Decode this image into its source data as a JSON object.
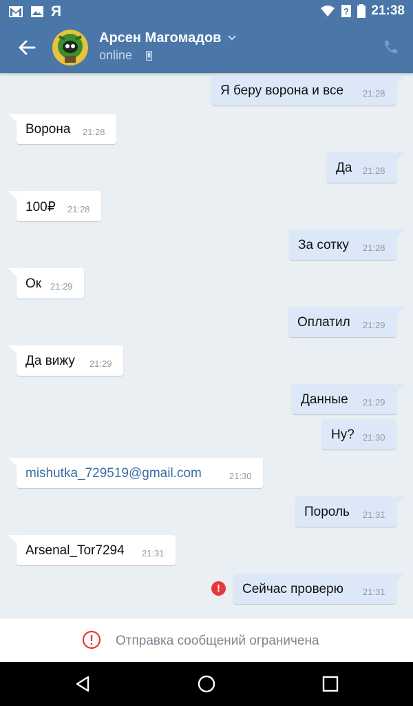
{
  "status_bar": {
    "time": "21:38",
    "left_icons": [
      "gmail-icon",
      "image-icon",
      "yandex-icon"
    ],
    "yandex_glyph": "Я",
    "right_icons": [
      "wifi-icon",
      "signal-icon",
      "battery-icon"
    ]
  },
  "header": {
    "contact_name": "Арсен Магомадов",
    "presence": "online",
    "icons": [
      "back-arrow-icon",
      "avatar",
      "chevron-down-icon",
      "mobile-icon",
      "phone-call-icon"
    ]
  },
  "messages": [
    {
      "dir": "out",
      "text": "Я беру ворона и все",
      "time": "21:28"
    },
    {
      "dir": "in",
      "text": "Ворона",
      "time": "21:28"
    },
    {
      "dir": "out",
      "text": "Да",
      "time": "21:28"
    },
    {
      "dir": "in",
      "text": "100₽",
      "time": "21:28"
    },
    {
      "dir": "out",
      "text": "За сотку",
      "time": "21:28"
    },
    {
      "dir": "in",
      "text": "Ок",
      "time": "21:29"
    },
    {
      "dir": "out",
      "text": "Оплатил",
      "time": "21:29"
    },
    {
      "dir": "in",
      "text": "Да вижу",
      "time": "21:29"
    },
    {
      "dir": "out",
      "text": "Данные",
      "time": "21:29"
    },
    {
      "dir": "out",
      "text": "Ну?",
      "time": "21:30"
    },
    {
      "dir": "in",
      "text": "mishutka_729519@gmail.com",
      "time": "21:30",
      "is_link": true
    },
    {
      "dir": "out",
      "text": "Пороль",
      "time": "21:31"
    },
    {
      "dir": "in",
      "text": "Arsenal_Tor7294",
      "time": "21:31"
    },
    {
      "dir": "out",
      "text": "Сейчас проверю",
      "time": "21:31",
      "error": true
    }
  ],
  "error_glyph": "!",
  "notice": {
    "text": "Отправка сообщений ограничена",
    "icon": "alert-circle-icon",
    "color": "#e5383b"
  },
  "nav_bar": {
    "icons": [
      "back-triangle-icon",
      "home-circle-icon",
      "recents-square-icon"
    ]
  },
  "colors": {
    "header": "#4a76a8",
    "incoming_bubble": "#ffffff",
    "outgoing_bubble": "#dce8f8",
    "background": "#eaeff4",
    "link": "#3b6ea5"
  }
}
